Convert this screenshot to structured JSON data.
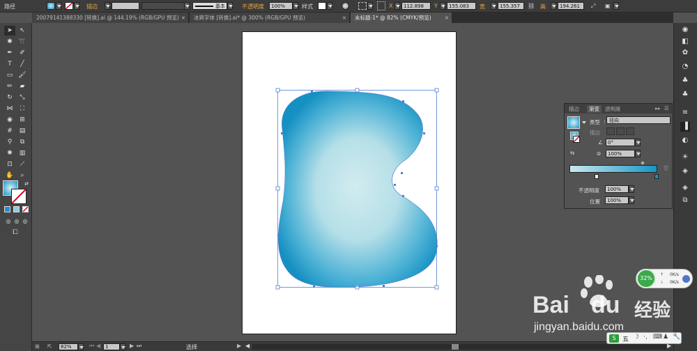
{
  "control_bar": {
    "object_type": "路径",
    "stroke_label": "描边",
    "stroke_weight": "",
    "brush_label": "基本",
    "opacity_label": "不透明度",
    "opacity_value": "100%",
    "style_label": "样式",
    "x_label": "X",
    "x_value": "112.898",
    "y_label": "Y",
    "y_value": "155.083",
    "w_label": "宽",
    "w_value": "155.357",
    "h_label": "高",
    "h_value": "194.261"
  },
  "doc_tabs": [
    {
      "label": "20079141388330 [转换].ai @ 144.19% (RGB/GPU 预览)",
      "close": "×"
    },
    {
      "label": "冰爽字体 [转换].ai* @ 300% (RGB/GPU 预览)",
      "close": "×"
    },
    {
      "label": "未标题-1* @ 82% (CMYK/预览)",
      "close": "×"
    }
  ],
  "gradient_panel": {
    "tabs": [
      "描边",
      "渐变",
      "透明度"
    ],
    "type_label": "类型",
    "type_value": "径向",
    "stroke_label": "描边",
    "angle_value": "0°",
    "aspect_value": "100%",
    "opacity_label": "不透明度",
    "opacity_value": "100%",
    "location_label": "位置",
    "location_value": "100%"
  },
  "status_bar": {
    "zoom": "82%",
    "artboard": "1",
    "tool": "选择"
  },
  "net_widget": {
    "percent": "32%",
    "up": "0K/s",
    "down": "0K/s"
  },
  "ime": {
    "label": "五"
  },
  "watermark": {
    "brand": "Bai",
    "brand2": "du",
    "sub": "经验",
    "url": "jingyan.baidu.com"
  },
  "colors": {
    "gradient_light": "#cfe9ee",
    "gradient_dark": "#1795c6",
    "selection": "#4f7fd1",
    "accent_orange": "#e8a640"
  }
}
